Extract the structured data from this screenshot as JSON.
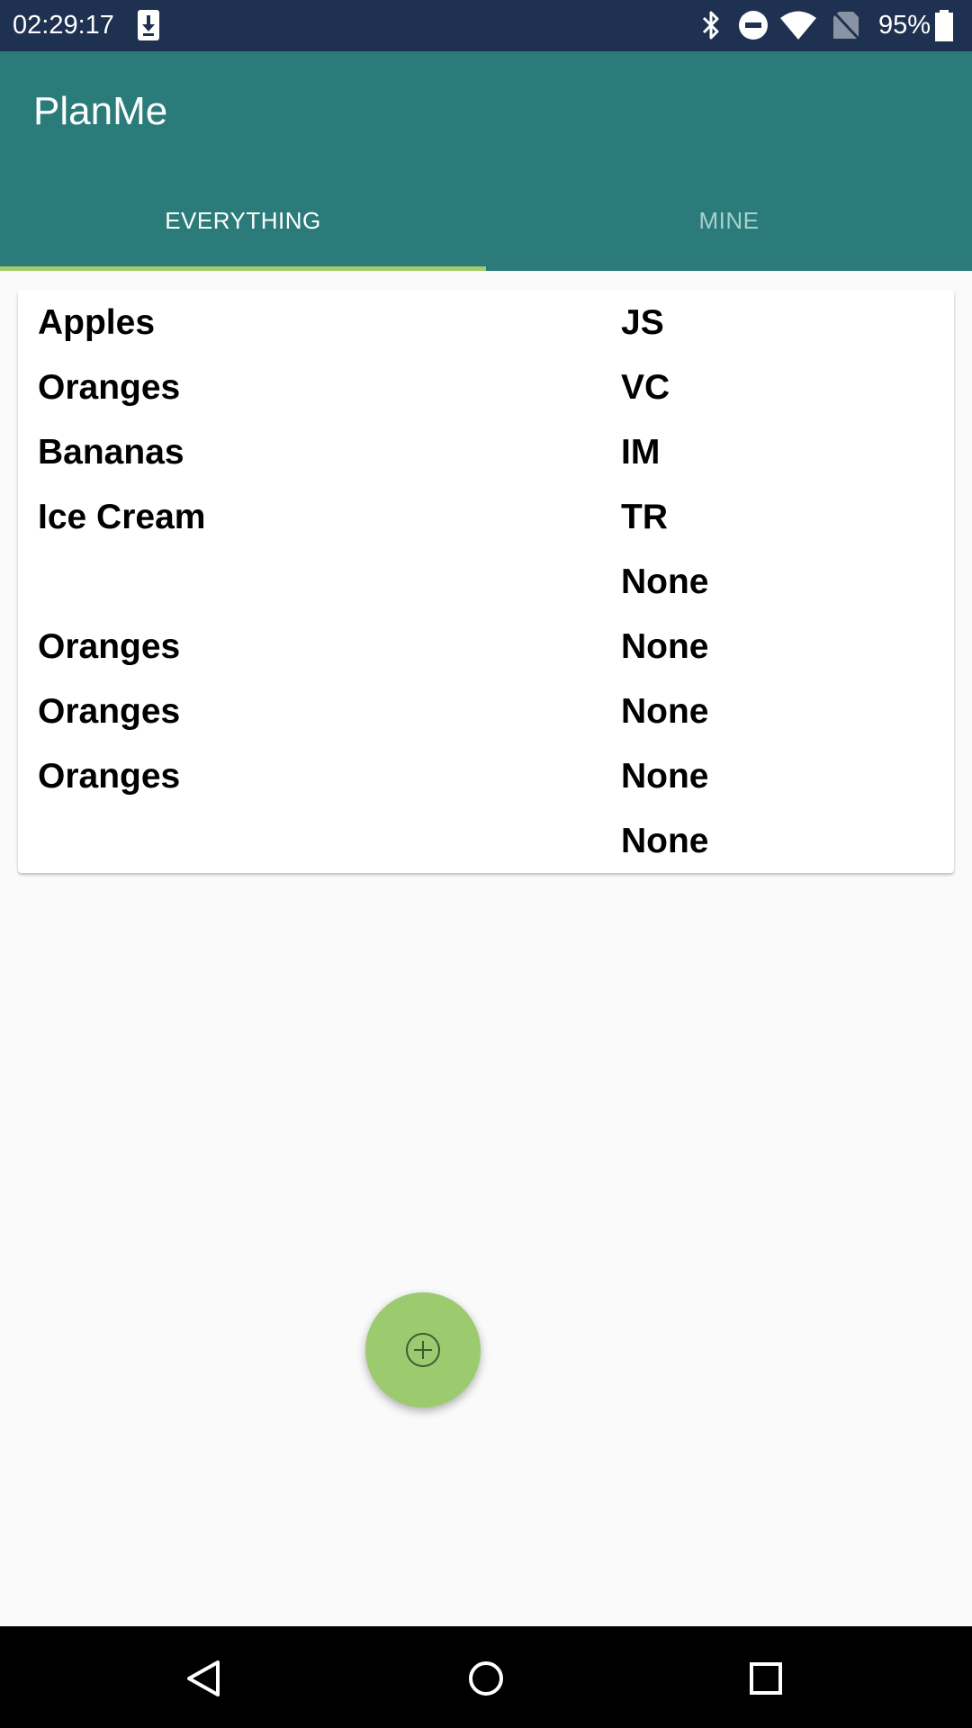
{
  "status_bar": {
    "time": "02:29:17",
    "battery_percent": "95%",
    "icons": [
      "download-icon",
      "bluetooth-icon",
      "do-not-disturb-icon",
      "wifi-icon",
      "no-sim-icon",
      "battery-icon"
    ]
  },
  "app": {
    "title": "PlanMe"
  },
  "tabs": [
    {
      "label": "EVERYTHING",
      "selected": true
    },
    {
      "label": "MINE",
      "selected": false
    }
  ],
  "list": {
    "rows": [
      {
        "name": "Apples",
        "owner": "JS"
      },
      {
        "name": "Oranges",
        "owner": "VC"
      },
      {
        "name": "Bananas",
        "owner": "IM"
      },
      {
        "name": "Ice Cream",
        "owner": "TR"
      },
      {
        "name": "",
        "owner": "None"
      },
      {
        "name": "Oranges",
        "owner": "None"
      },
      {
        "name": "Oranges",
        "owner": "None"
      },
      {
        "name": "Oranges",
        "owner": "None"
      },
      {
        "name": "",
        "owner": "None"
      }
    ]
  },
  "fab": {
    "icon": "add-circle-icon"
  },
  "nav_bar": {
    "buttons": [
      "back-icon",
      "home-icon",
      "recents-icon"
    ]
  },
  "colors": {
    "status_bar": "#1f3150",
    "app_bar": "#2a7b7a",
    "tab_indicator": "#a5cc6b",
    "fab": "#9ccb6f",
    "background": "#fafafa"
  }
}
